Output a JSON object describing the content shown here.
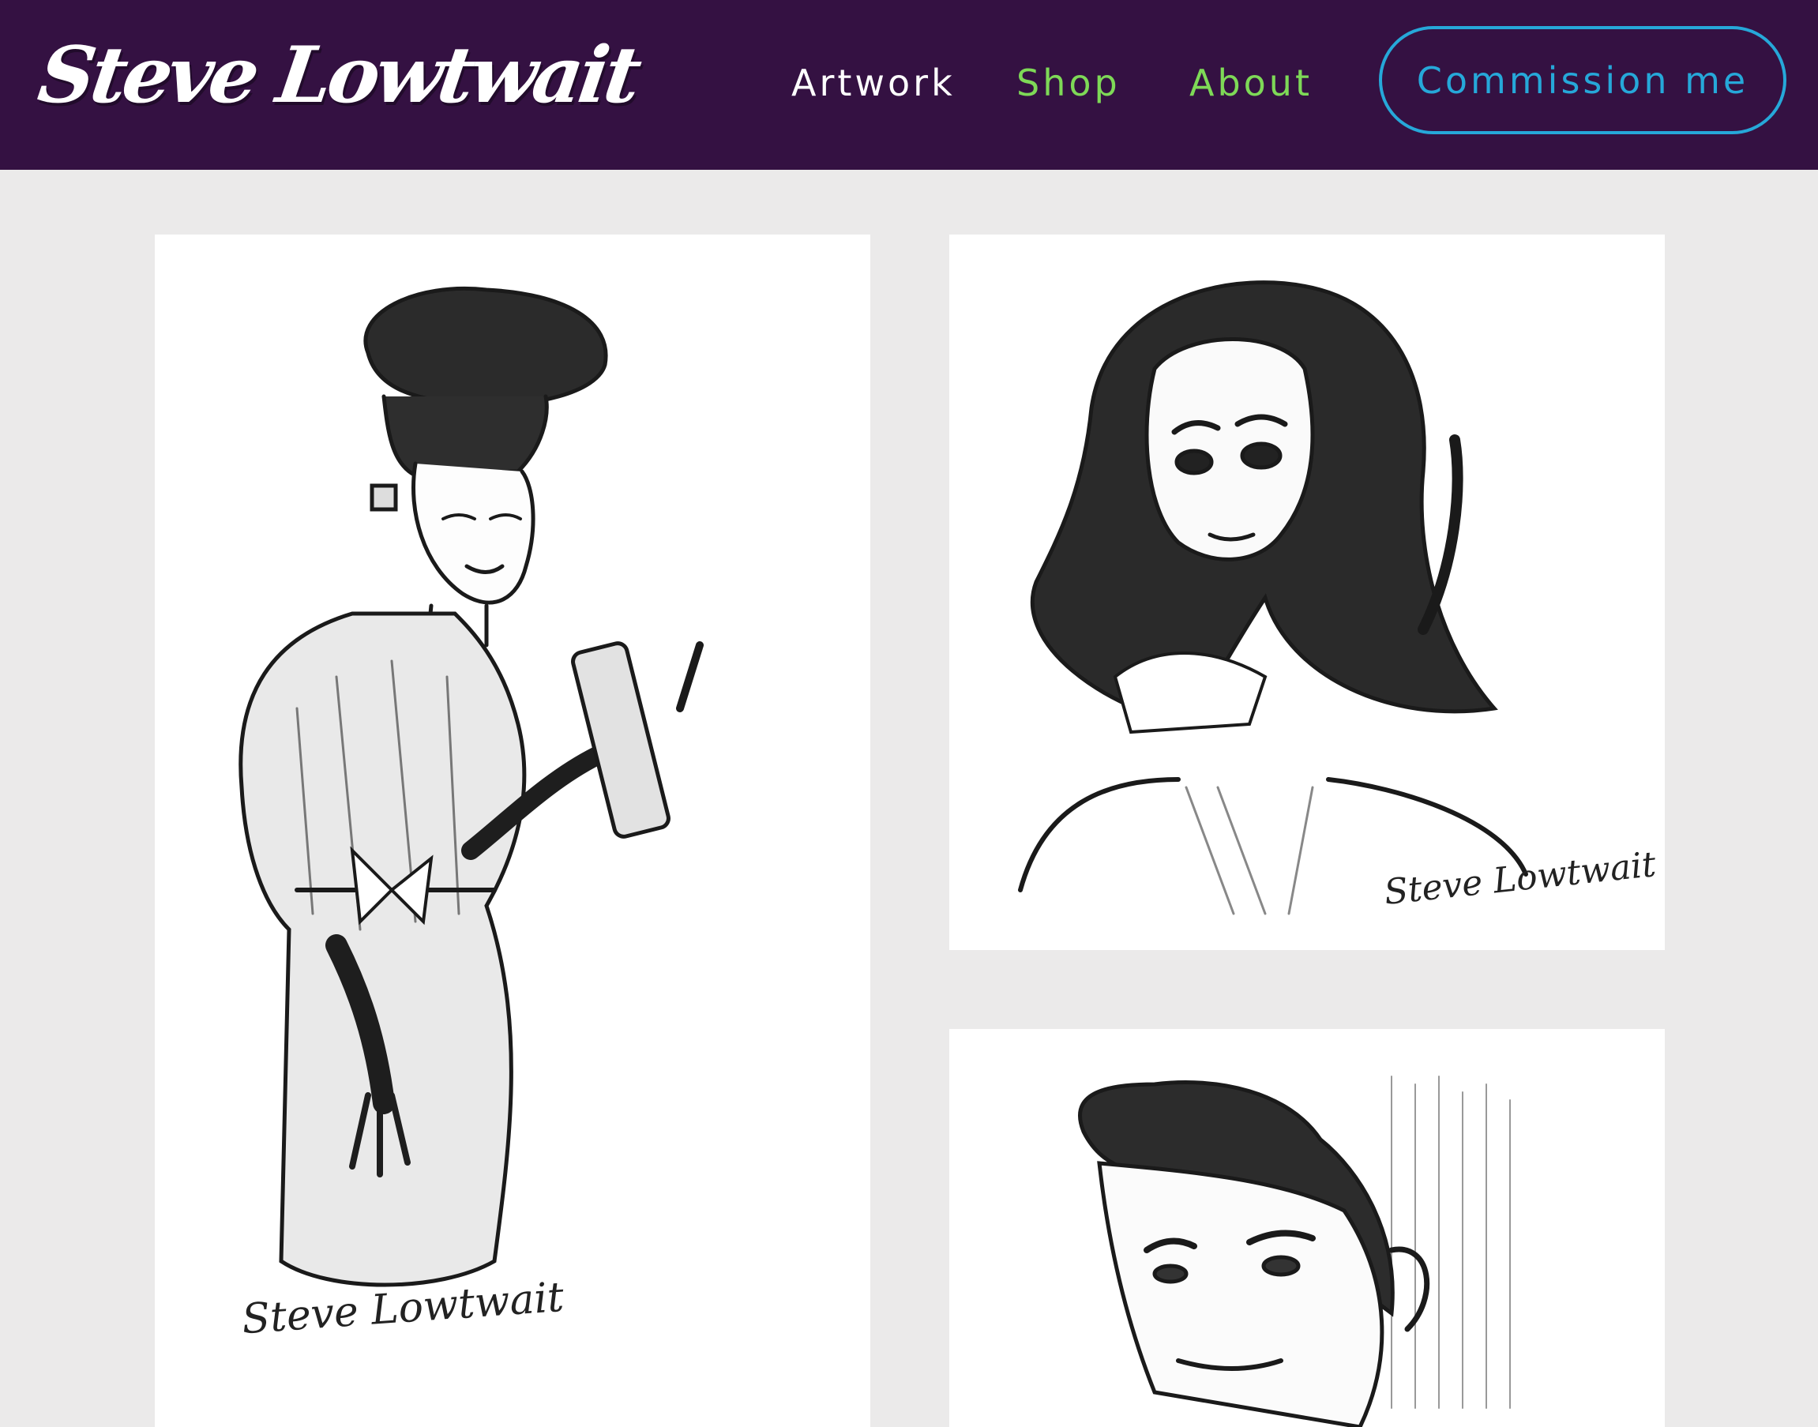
{
  "header": {
    "logo": "Steve Lowtwait",
    "nav": [
      {
        "label": "Artwork",
        "color": "#ffffff"
      },
      {
        "label": "Shop",
        "color": "#7ed957"
      },
      {
        "label": "About",
        "color": "#7ed957"
      }
    ],
    "cta_label": "Commission me"
  },
  "colors": {
    "header_bg": "#341142",
    "page_bg": "#ebeaea",
    "accent_green": "#7ed957",
    "accent_blue": "#26a8d9"
  },
  "gallery": [
    {
      "subject": "retro-fashion-woman-sketch",
      "signature": "Steve Lowtwait"
    },
    {
      "subject": "woman-portrait-sketch",
      "signature": "Steve Lowtwait"
    },
    {
      "subject": "man-portrait-sketch"
    }
  ]
}
